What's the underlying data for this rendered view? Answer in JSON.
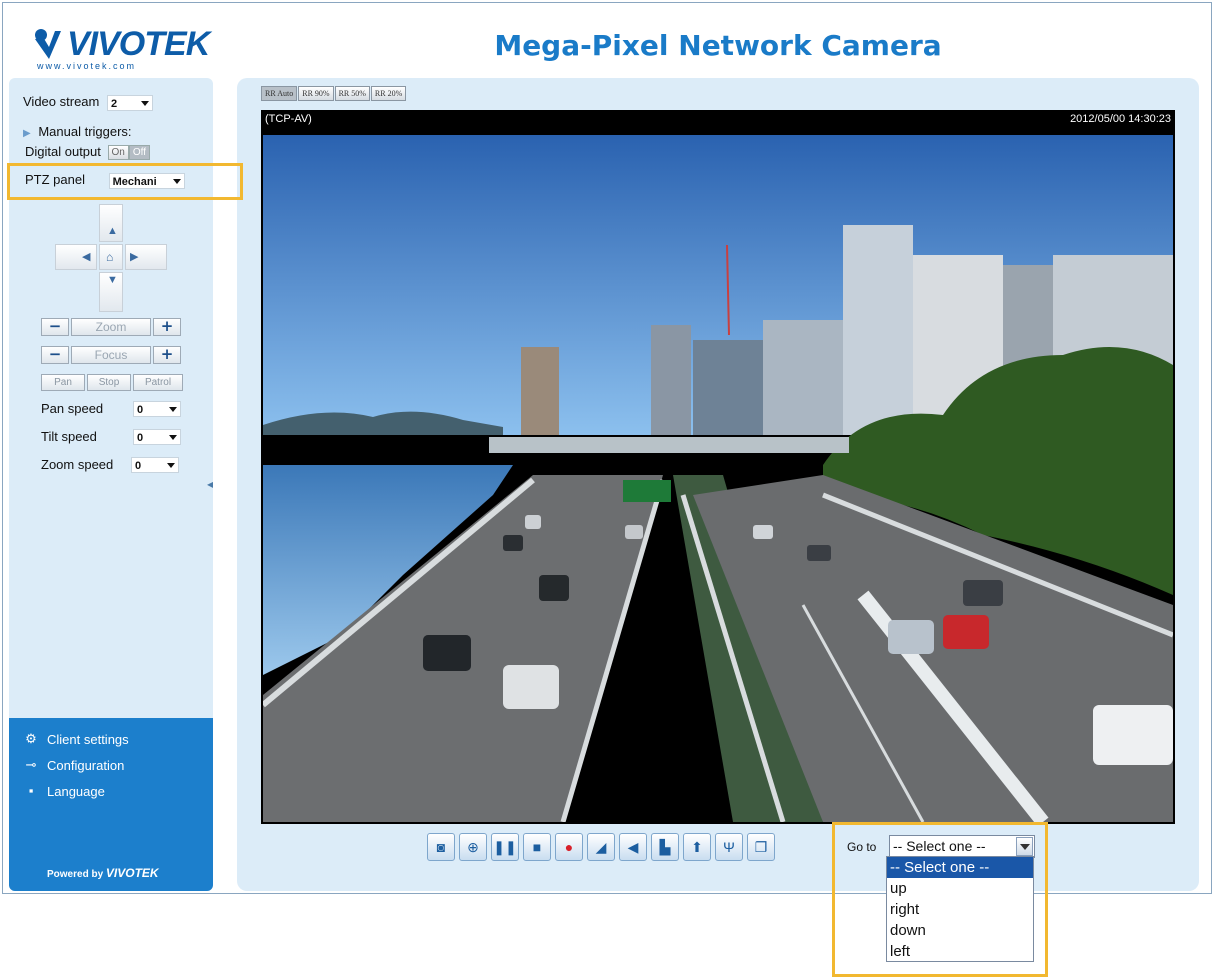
{
  "header": {
    "logo_text": "VIVOTEK",
    "logo_sub": "www.vivotek.com",
    "title": "Mega-Pixel Network Camera"
  },
  "sidebar": {
    "video_stream_label": "Video stream",
    "video_stream_value": "2",
    "manual_triggers_label": "Manual triggers:",
    "digital_output_label": "Digital output",
    "digital_output_on": "On",
    "digital_output_off": "Off",
    "ptz_panel_label": "PTZ panel",
    "ptz_panel_value": "Mechani",
    "zoom_label": "Zoom",
    "focus_label": "Focus",
    "minus": "−",
    "plus": "+",
    "pan_label": "Pan",
    "stop_label": "Stop",
    "patrol_label": "Patrol",
    "pan_speed_label": "Pan speed",
    "pan_speed_value": "0",
    "tilt_speed_label": "Tilt speed",
    "tilt_speed_value": "0",
    "zoom_speed_label": "Zoom speed",
    "zoom_speed_value": "0",
    "menu": {
      "client_settings": "Client settings",
      "configuration": "Configuration",
      "language": "Language"
    },
    "powered_by": "Powered by",
    "powered_brand": "VIVOTEK"
  },
  "main": {
    "stream_tabs": [
      "RR Auto",
      "RR 90%",
      "RR 50%",
      "RR 20%"
    ],
    "video_protocol": "(TCP-AV)",
    "video_timestamp": "2012/05/00 14:30:23",
    "goto_label": "Go to",
    "goto_selected": "-- Select one --",
    "goto_options": [
      "-- Select one --",
      "up",
      "right",
      "down",
      "left"
    ]
  },
  "toolbar_icons": [
    "snapshot-icon",
    "digital-zoom-icon",
    "pause-icon",
    "stop-icon",
    "record-icon",
    "volume-icon",
    "mute-icon",
    "talk-icon",
    "upload-icon",
    "microphone-icon",
    "fullscreen-icon"
  ],
  "colors": {
    "brand_blue": "#1a7bc8",
    "panel_bg": "#dcecf8",
    "menu_bg": "#1c7fcc",
    "highlight": "#f2b830",
    "dropdown_selected": "#1a57a8"
  }
}
